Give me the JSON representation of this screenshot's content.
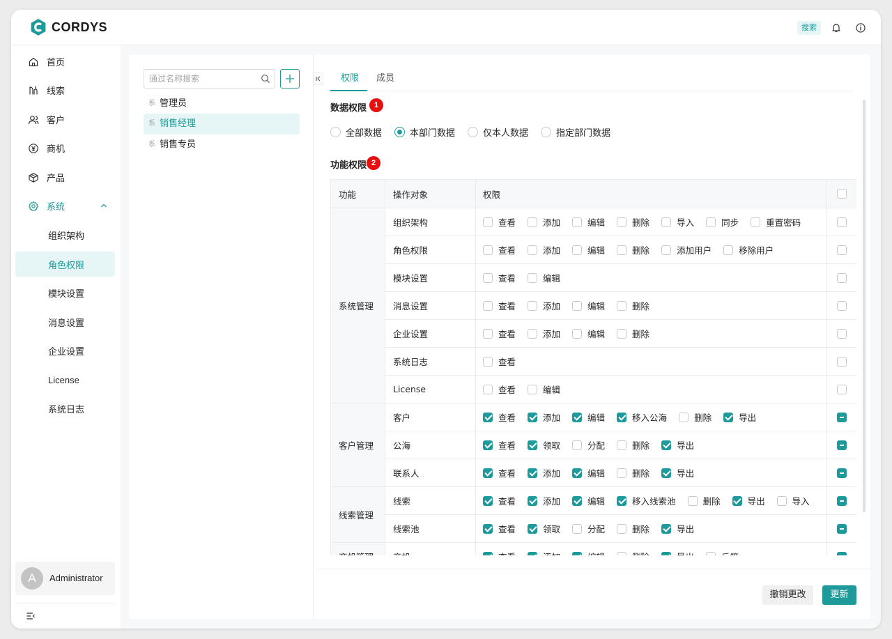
{
  "app": {
    "name": "CORDYS"
  },
  "topbar": {
    "search_label": "搜索"
  },
  "sidebar": {
    "items": [
      {
        "label": "首页",
        "icon": "home-icon"
      },
      {
        "label": "线索",
        "icon": "leads-icon"
      },
      {
        "label": "客户",
        "icon": "customer-icon"
      },
      {
        "label": "商机",
        "icon": "opportunity-icon"
      },
      {
        "label": "产品",
        "icon": "product-icon"
      },
      {
        "label": "系统",
        "icon": "gear-icon",
        "expanded": true
      }
    ],
    "sub_items": [
      {
        "label": "组织架构"
      },
      {
        "label": "角色权限",
        "active": true
      },
      {
        "label": "模块设置"
      },
      {
        "label": "消息设置"
      },
      {
        "label": "企业设置"
      },
      {
        "label": "License"
      },
      {
        "label": "系统日志"
      }
    ],
    "user": {
      "initial": "A",
      "name": "Administrator"
    }
  },
  "roles": {
    "search_placeholder": "通过名称搜索",
    "list": [
      {
        "tag": "系",
        "label": "管理员",
        "active": false
      },
      {
        "tag": "系",
        "label": "销售经理",
        "active": true
      },
      {
        "tag": "系",
        "label": "销售专员",
        "active": false
      }
    ]
  },
  "tabs": [
    {
      "label": "权限",
      "active": true
    },
    {
      "label": "成员",
      "active": false
    }
  ],
  "data_permission": {
    "title": "数据权限",
    "badge": "1",
    "options": [
      {
        "label": "全部数据",
        "checked": false
      },
      {
        "label": "本部门数据",
        "checked": true
      },
      {
        "label": "仅本人数据",
        "checked": false
      },
      {
        "label": "指定部门数据",
        "checked": false
      }
    ]
  },
  "function_permission": {
    "title": "功能权限",
    "badge": "2",
    "headers": {
      "function": "功能",
      "object": "操作对象",
      "permission": "权限"
    },
    "groups": [
      {
        "name": "系统管理",
        "rows": [
          {
            "object": "组织架构",
            "all": "none",
            "perms": [
              [
                "查看",
                false
              ],
              [
                "添加",
                false
              ],
              [
                "编辑",
                false
              ],
              [
                "删除",
                false
              ],
              [
                "导入",
                false
              ],
              [
                "同步",
                false
              ],
              [
                "重置密码",
                false
              ]
            ]
          },
          {
            "object": "角色权限",
            "all": "none",
            "perms": [
              [
                "查看",
                false
              ],
              [
                "添加",
                false
              ],
              [
                "编辑",
                false
              ],
              [
                "删除",
                false
              ],
              [
                "添加用户",
                false
              ],
              [
                "移除用户",
                false
              ]
            ]
          },
          {
            "object": "模块设置",
            "all": "none",
            "perms": [
              [
                "查看",
                false
              ],
              [
                "编辑",
                false
              ]
            ]
          },
          {
            "object": "消息设置",
            "all": "none",
            "perms": [
              [
                "查看",
                false
              ],
              [
                "添加",
                false
              ],
              [
                "编辑",
                false
              ],
              [
                "删除",
                false
              ]
            ]
          },
          {
            "object": "企业设置",
            "all": "none",
            "perms": [
              [
                "查看",
                false
              ],
              [
                "添加",
                false
              ],
              [
                "编辑",
                false
              ],
              [
                "删除",
                false
              ]
            ]
          },
          {
            "object": "系统日志",
            "all": "none",
            "perms": [
              [
                "查看",
                false
              ]
            ]
          },
          {
            "object": "License",
            "all": "none",
            "perms": [
              [
                "查看",
                false
              ],
              [
                "编辑",
                false
              ]
            ]
          }
        ]
      },
      {
        "name": "客户管理",
        "rows": [
          {
            "object": "客户",
            "all": "partial",
            "perms": [
              [
                "查看",
                true
              ],
              [
                "添加",
                true
              ],
              [
                "编辑",
                true
              ],
              [
                "移入公海",
                true
              ],
              [
                "删除",
                false
              ],
              [
                "导出",
                true
              ]
            ]
          },
          {
            "object": "公海",
            "all": "partial",
            "perms": [
              [
                "查看",
                true
              ],
              [
                "领取",
                true
              ],
              [
                "分配",
                false
              ],
              [
                "删除",
                false
              ],
              [
                "导出",
                true
              ]
            ]
          },
          {
            "object": "联系人",
            "all": "partial",
            "perms": [
              [
                "查看",
                true
              ],
              [
                "添加",
                true
              ],
              [
                "编辑",
                true
              ],
              [
                "删除",
                false
              ],
              [
                "导出",
                true
              ]
            ]
          }
        ]
      },
      {
        "name": "线索管理",
        "rows": [
          {
            "object": "线索",
            "all": "partial",
            "perms": [
              [
                "查看",
                true
              ],
              [
                "添加",
                true
              ],
              [
                "编辑",
                true
              ],
              [
                "移入线索池",
                true
              ],
              [
                "删除",
                false
              ],
              [
                "导出",
                true
              ],
              [
                "导入",
                false
              ]
            ]
          },
          {
            "object": "线索池",
            "all": "partial",
            "perms": [
              [
                "查看",
                true
              ],
              [
                "领取",
                true
              ],
              [
                "分配",
                false
              ],
              [
                "删除",
                false
              ],
              [
                "导出",
                true
              ]
            ]
          }
        ]
      },
      {
        "name": "商机管理",
        "rows": [
          {
            "object": "商机",
            "all": "partial",
            "perms": [
              [
                "查看",
                true
              ],
              [
                "添加",
                true
              ],
              [
                "编辑",
                true
              ],
              [
                "删除",
                false
              ],
              [
                "导出",
                true
              ],
              [
                "反签",
                false
              ]
            ]
          }
        ]
      }
    ]
  },
  "footer": {
    "cancel_label": "撤销更改",
    "update_label": "更新"
  },
  "colors": {
    "accent": "#1e9a9a",
    "accent_bg": "#e6f5f5",
    "badge": "#e61010"
  }
}
